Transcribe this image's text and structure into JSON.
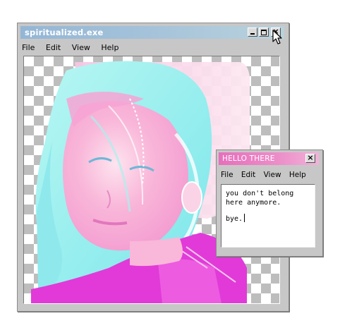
{
  "main_window": {
    "title": "spiritualized.exe",
    "menu": [
      "File",
      "Edit",
      "View",
      "Help"
    ],
    "image": "holographic pink and cyan portrait on transparent checkerboard"
  },
  "popup": {
    "title": "HELLO THERE",
    "menu": [
      "File",
      "Edit",
      "View",
      "Help"
    ],
    "text_line1": "you don't belong here anymore.",
    "text_line2": "bye."
  },
  "icons": {
    "minimize": "minimize-icon",
    "maximize": "maximize-icon",
    "close": "close-icon",
    "cursor": "arrow-cursor-icon"
  },
  "colors": {
    "main_titlebar": "#a7c4da",
    "popup_titlebar": "#ec8ec9",
    "window_chrome": "#c7c7c7",
    "portrait_pink": "#f9b7d9",
    "portrait_cyan": "#a6f2ee",
    "portrait_magenta": "#e13ad8"
  }
}
